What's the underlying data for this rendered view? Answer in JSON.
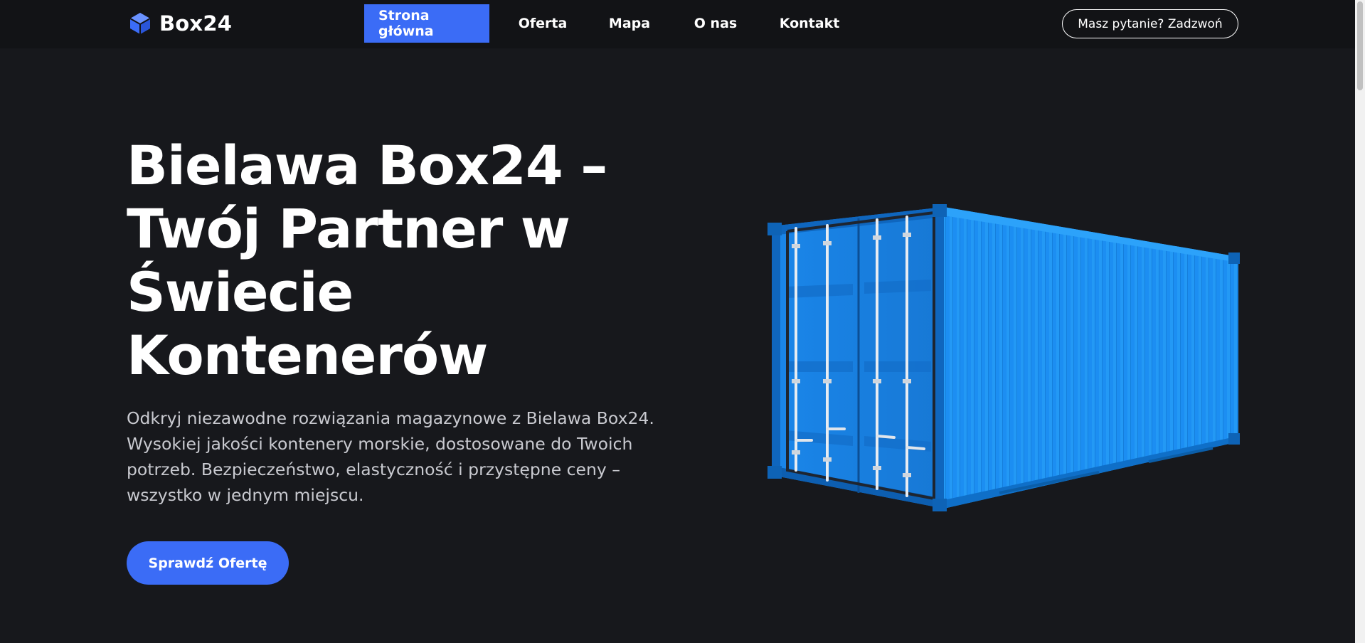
{
  "header": {
    "logo_text": "Box24",
    "nav": [
      {
        "label": "Strona główna",
        "active": true
      },
      {
        "label": "Oferta",
        "active": false
      },
      {
        "label": "Mapa",
        "active": false
      },
      {
        "label": "O nas",
        "active": false
      },
      {
        "label": "Kontakt",
        "active": false
      }
    ],
    "call_button": "Masz pytanie? Zadzwoń"
  },
  "hero": {
    "title_lines": [
      "Bielawa Box24 –",
      "Twój Partner w",
      "Świecie",
      "Kontenerów"
    ],
    "description_lines": [
      "Odkryj niezawodne rozwiązania magazynowe z Bielawa Box24.",
      "Wysokiej jakości kontenery morskie, dostosowane do Twoich",
      "potrzeb. Bezpieczeństwo, elastyczność i przystępne ceny –",
      "wszystko w jednym miejscu."
    ],
    "cta_label": "Sprawdź Ofertę",
    "image": "shipping-container"
  },
  "colors": {
    "accent": "#3b6cf6",
    "background": "#17181c",
    "header_bg": "#121316",
    "container_blue": "#1a8df0"
  }
}
